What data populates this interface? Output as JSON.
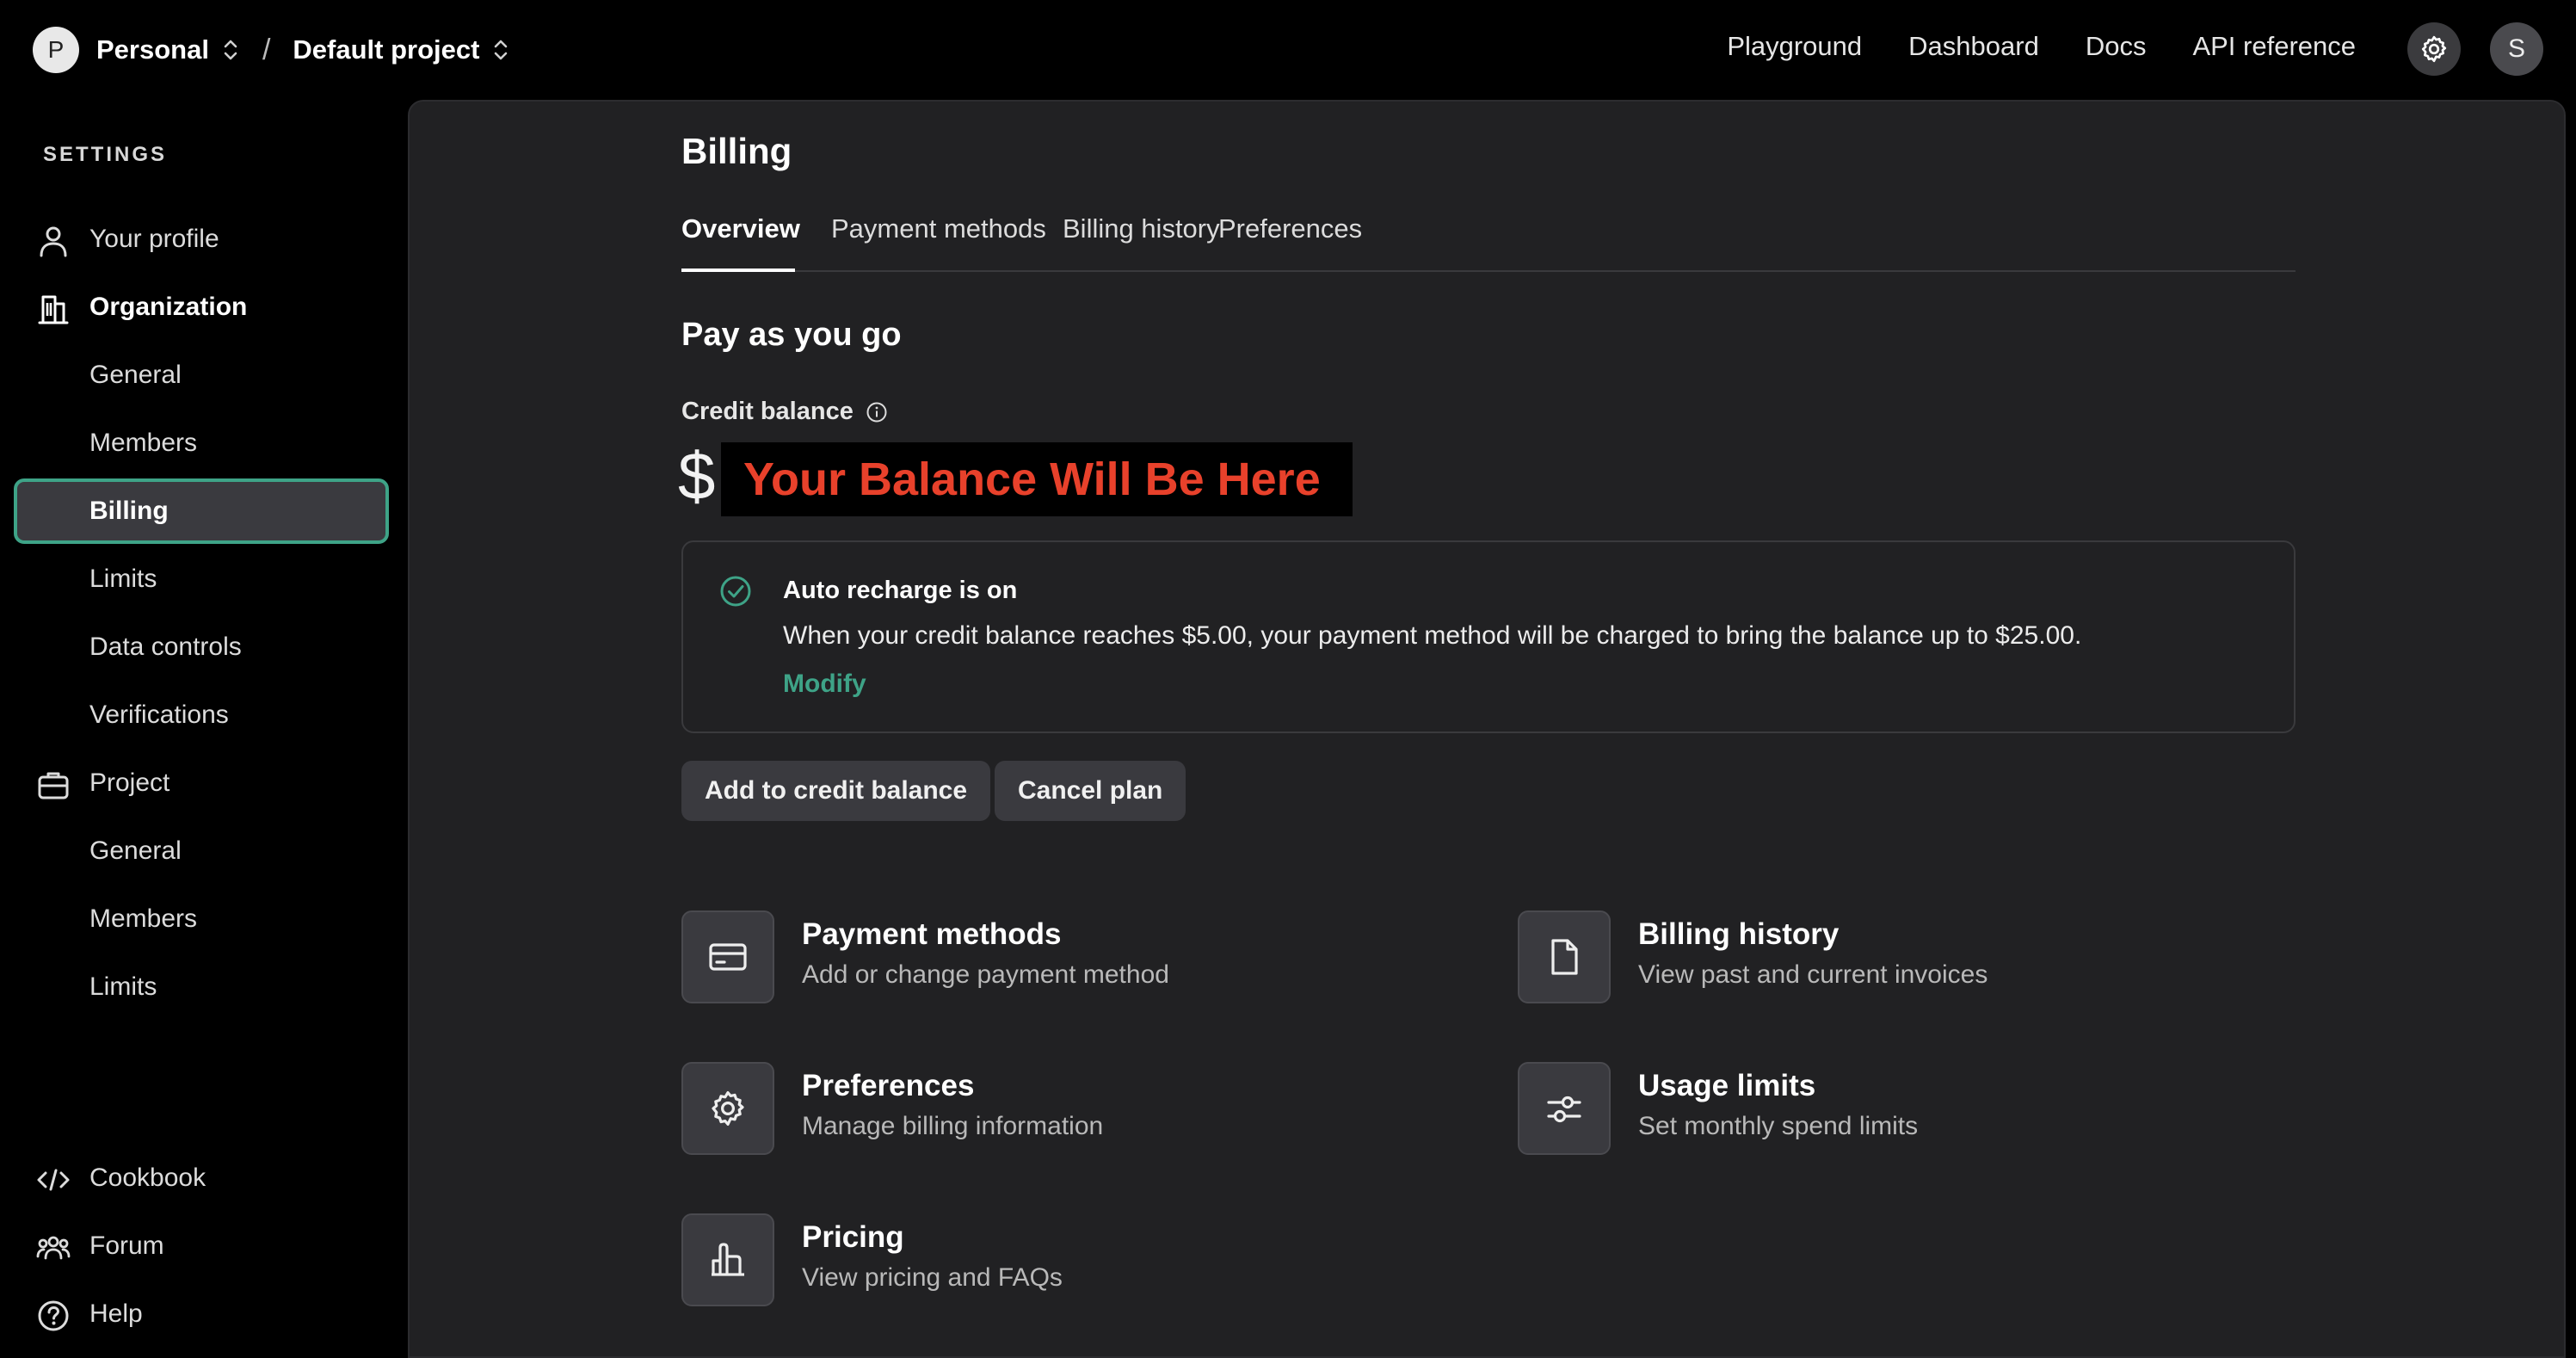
{
  "topbar": {
    "org_initial": "P",
    "org_name": "Personal",
    "separator": "/",
    "project_name": "Default project",
    "links": [
      "Playground",
      "Dashboard",
      "Docs",
      "API reference"
    ],
    "user_initial": "S"
  },
  "sidebar": {
    "heading": "SETTINGS",
    "items": [
      {
        "label": "Your profile",
        "icon": "person-icon"
      },
      {
        "label": "Organization",
        "icon": "building-icon"
      },
      {
        "label": "General"
      },
      {
        "label": "Members"
      },
      {
        "label": "Billing",
        "active": true
      },
      {
        "label": "Limits"
      },
      {
        "label": "Data controls"
      },
      {
        "label": "Verifications"
      },
      {
        "label": "Project",
        "icon": "briefcase-icon"
      },
      {
        "label": "General"
      },
      {
        "label": "Members"
      },
      {
        "label": "Limits"
      }
    ],
    "footer": [
      {
        "label": "Cookbook",
        "icon": "code-icon"
      },
      {
        "label": "Forum",
        "icon": "people-icon"
      },
      {
        "label": "Help",
        "icon": "help-icon"
      }
    ]
  },
  "main": {
    "title": "Billing",
    "tabs": [
      "Overview",
      "Payment methods",
      "Billing history",
      "Preferences"
    ],
    "active_tab": "Overview",
    "section_title": "Pay as you go",
    "credit_label": "Credit balance",
    "currency": "$",
    "balance_placeholder": "Your Balance Will Be Here",
    "recharge": {
      "title": "Auto recharge is on",
      "description": "When your credit balance reaches $5.00, your payment method will be charged to bring the balance up to $25.00.",
      "modify": "Modify"
    },
    "buttons": {
      "add_credit": "Add to credit balance",
      "cancel_plan": "Cancel plan"
    },
    "cards": [
      {
        "title": "Payment methods",
        "subtitle": "Add or change payment method",
        "icon": "credit-card-icon"
      },
      {
        "title": "Billing history",
        "subtitle": "View past and current invoices",
        "icon": "document-icon"
      },
      {
        "title": "Preferences",
        "subtitle": "Manage billing information",
        "icon": "gear-icon"
      },
      {
        "title": "Usage limits",
        "subtitle": "Set monthly spend limits",
        "icon": "sliders-icon"
      },
      {
        "title": "Pricing",
        "subtitle": "View pricing and FAQs",
        "icon": "bar-chart-icon"
      }
    ]
  },
  "colors": {
    "accent": "#3ea387",
    "balance_text": "#e8412b",
    "panel": "#212123",
    "button": "#3a3a3f"
  }
}
